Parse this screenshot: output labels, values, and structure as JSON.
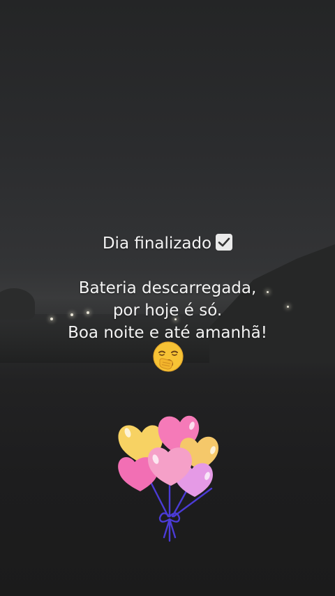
{
  "message": {
    "title": "Dia finalizado",
    "line1": "Bateria descarregada,",
    "line2": "por hoje é só.",
    "line3": "Boa noite e até amanhã!"
  },
  "stickers": {
    "check": "check-mark-emoji",
    "yawn": "yawning-face-emoji",
    "balloons": "heart-balloons-sticker"
  },
  "colors": {
    "text": "#f4f4f4",
    "sky": "#2b2c2e",
    "ground": "#1d1d1e"
  }
}
